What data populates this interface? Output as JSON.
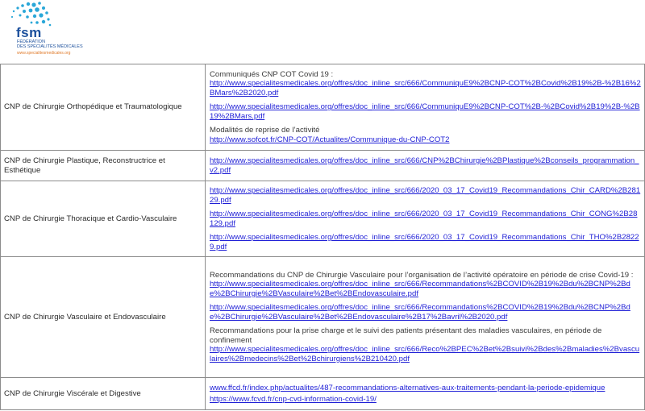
{
  "logo": {
    "initials": "fsm",
    "line1": "FÉDÉRATION",
    "line2": "DES SPÉCIALITÉS MÉDICALES",
    "url": "www.specialitesmedicales.org",
    "colors": {
      "dots": "#2aa7d8",
      "text": "#1b4f9c",
      "url": "#e07a2a"
    }
  },
  "colors": {
    "link": "#1f1fd6",
    "border": "#8c8c8c",
    "text": "#2b2b2b"
  },
  "rows": [
    {
      "cnp": "CNP de Chirurgie Orthopédique et Traumatologique",
      "label1": "Communiqués CNP COT Covid 19 :",
      "link1": "http://www.specialitesmedicales.org/offres/doc_inline_src/666/CommuniquE9%2BCNP-COT%2BCovid%2B19%2B-%2B16%2BMars%2B2020.pdf",
      "link2": "http://www.specialitesmedicales.org/offres/doc_inline_src/666/CommuniquE9%2BCNP-COT%2B-%2BCovid%2B19%2B-%2B19%2BMars.pdf",
      "label2": "Modalités de reprise de l’activité",
      "link3": "http://www.sofcot.fr/CNP-COT/Actualites/Communique-du-CNP-COT2"
    },
    {
      "cnp": "CNP de Chirurgie Plastique, Reconstructrice et Esthétique",
      "link1": "http://www.specialitesmedicales.org/offres/doc_inline_src/666/CNP%2BChirurgie%2BPlastique%2Bconseils_programmation_v2.pdf"
    },
    {
      "cnp": "CNP de Chirurgie Thoracique et Cardio-Vasculaire",
      "link1": "http://www.specialitesmedicales.org/offres/doc_inline_src/666/2020_03_17_Covid19_Recommandations_Chir_CARD%2B28129.pdf",
      "link2": "http://www.specialitesmedicales.org/offres/doc_inline_src/666/2020_03_17_Covid19_Recommandations_Chir_CONG%2B28129.pdf",
      "link3": "http://www.specialitesmedicales.org/offres/doc_inline_src/666/2020_03_17_Covid19_Recommandations_Chir_THO%2B28229.pdf"
    },
    {
      "cnp": "CNP de Chirurgie Vasculaire et Endovasculaire",
      "label1": "Recommandations du CNP de Chirurgie Vasculaire pour l’organisation de l’activité opératoire en période de crise Covid-19 :",
      "link1": "http://www.specialitesmedicales.org/offres/doc_inline_src/666/Recommandations%2BCOVID%2B19%2Bdu%2BCNP%2Bde%2BChirurgie%2BVasculaire%2Bet%2BEndovasculaire.pdf",
      "link2": "http://www.specialitesmedicales.org/offres/doc_inline_src/666/Recommandations%2BCOVID%2B19%2Bdu%2BCNP%2Bde%2BChirurgie%2BVasculaire%2Bet%2BEndovasculaire%2B17%2Bavril%2B2020.pdf",
      "label2": "Recommandations pour la prise charge et le suivi des patients présentant des maladies vasculaires, en période de confinement",
      "link3": "http://www.specialitesmedicales.org/offres/doc_inline_src/666/Reco%2BPEC%2Bet%2Bsuivi%2Bdes%2Bmaladies%2Bvasculaires%2Bmedecins%2Bet%2Bchirurgiens%2B210420.pdf"
    },
    {
      "cnp": "CNP de Chirurgie Viscérale et Digestive",
      "link1": "www.ffcd.fr/index.php/actualites/487-recommandations-alternatives-aux-traitements-pendant-la-periode-epidemique",
      "link2": "https://www.fcvd.fr/cnp-cvd-information-covid-19/"
    }
  ]
}
